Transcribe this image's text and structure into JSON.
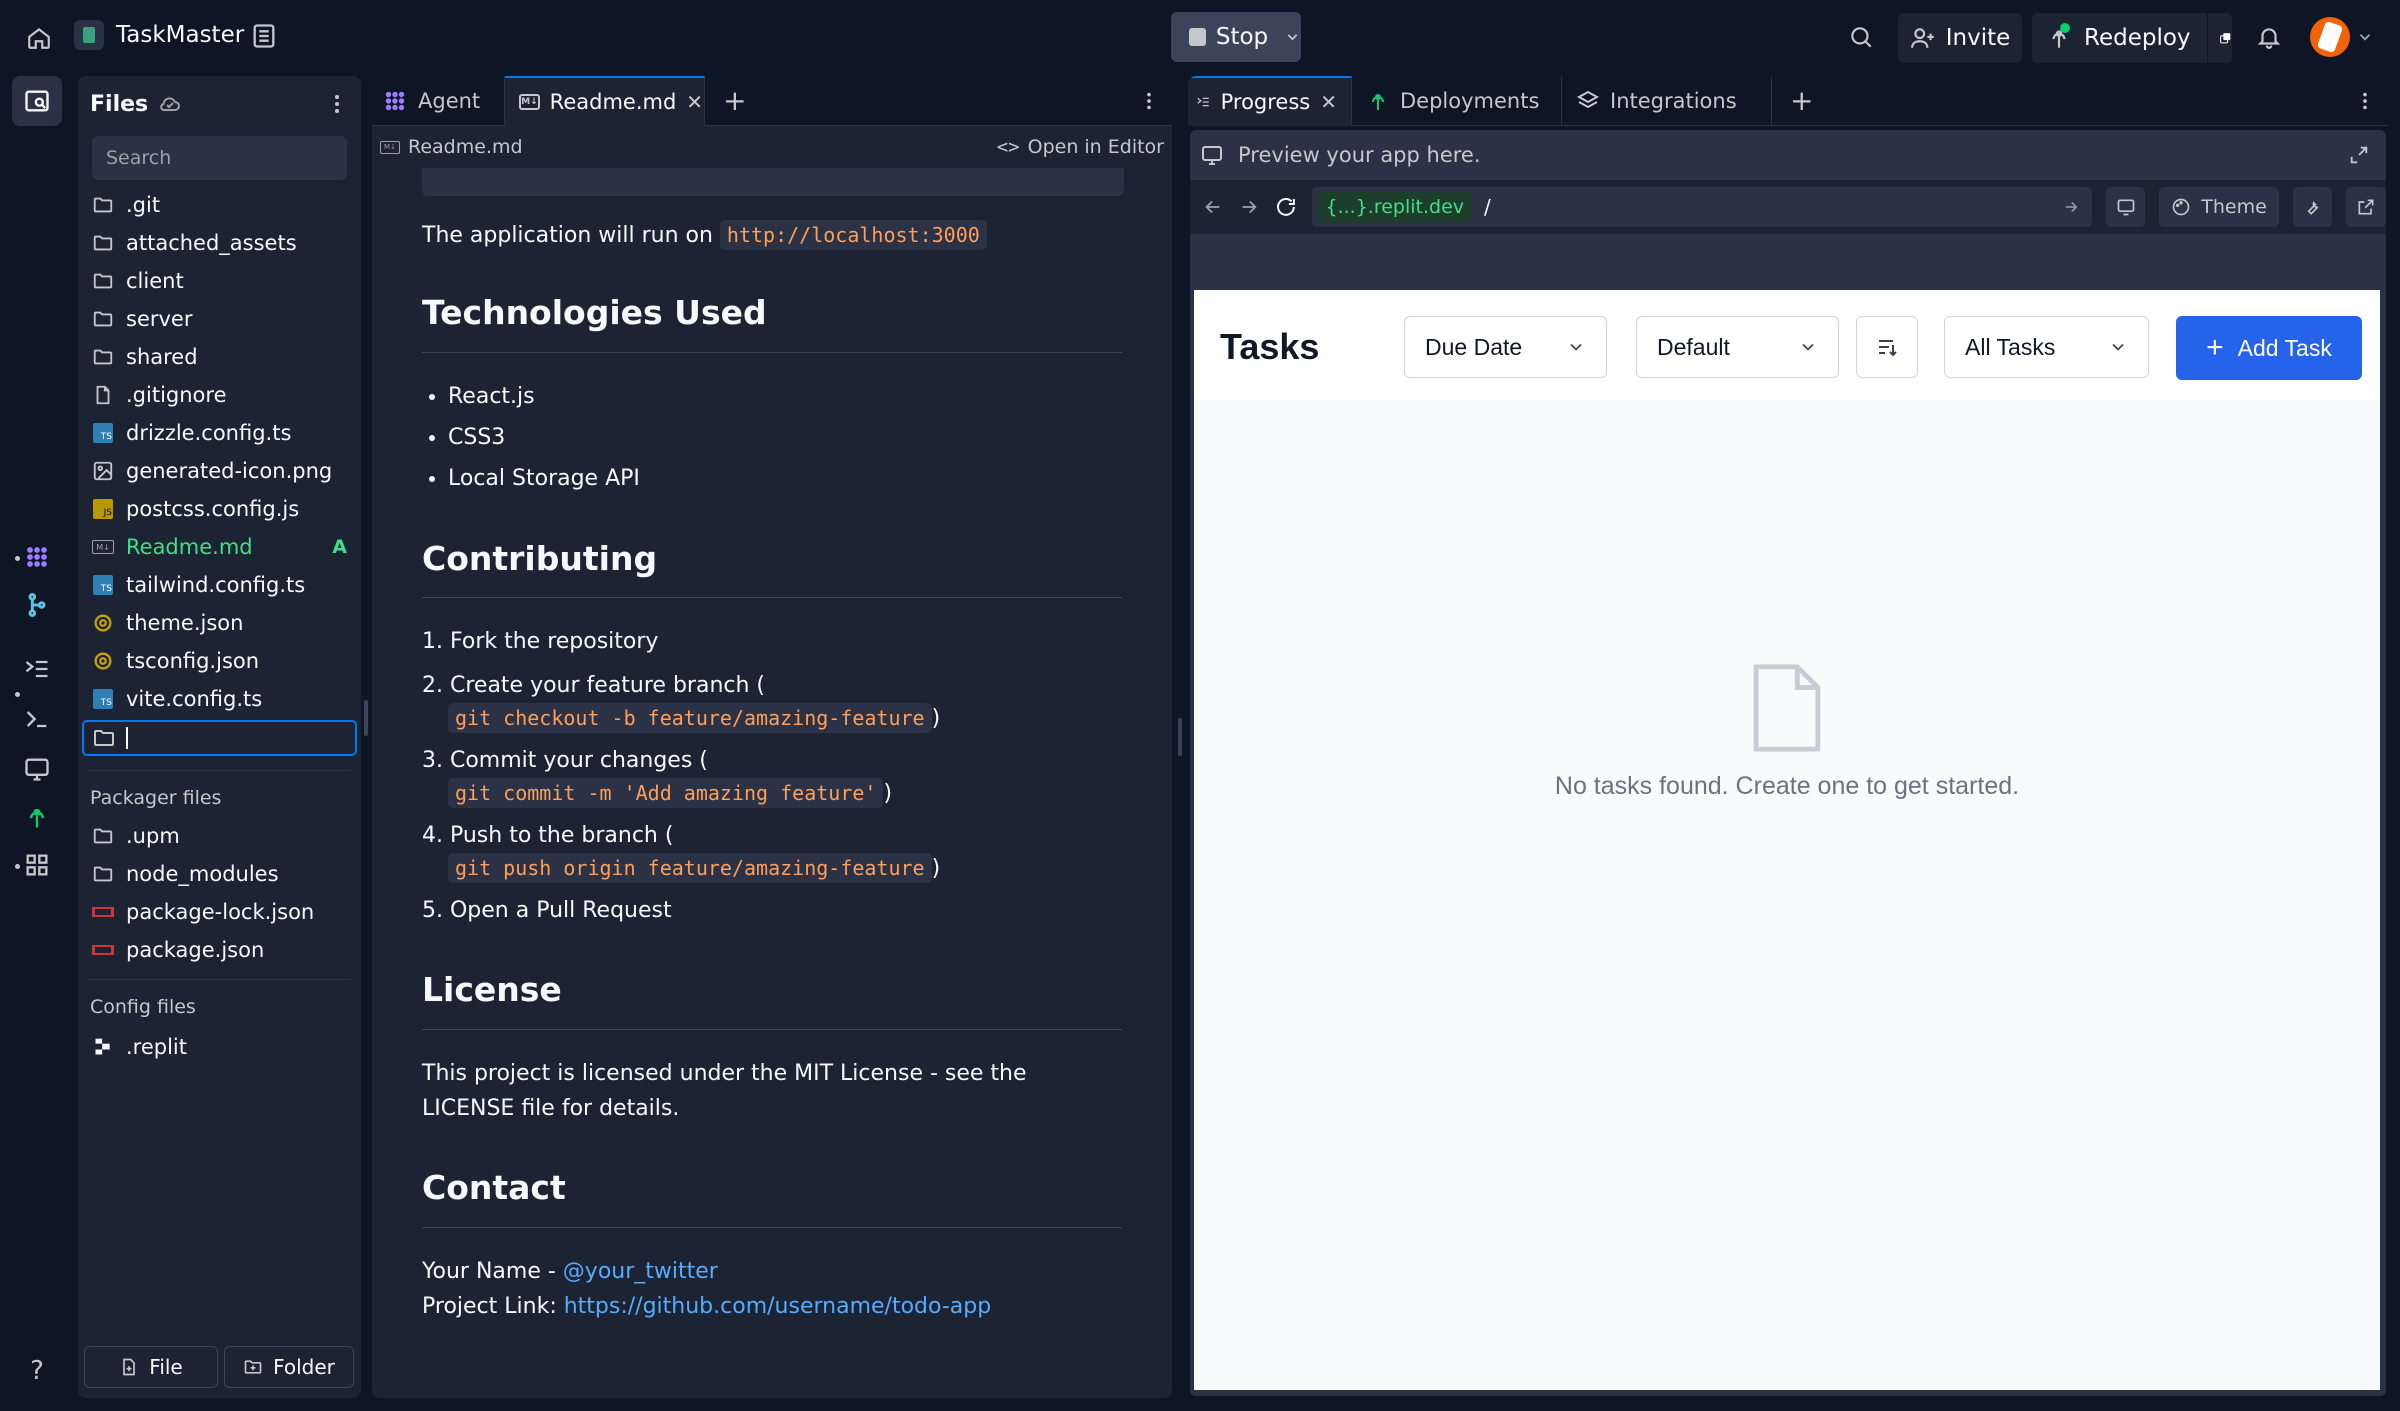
{
  "app": {
    "name": "TaskMaster"
  },
  "top": {
    "stop_label": "Stop",
    "invite_label": "Invite",
    "redeploy_label": "Redeploy"
  },
  "files": {
    "title": "Files",
    "search_placeholder": "Search",
    "items": [
      {
        "name": ".git",
        "icon": "folder-icon"
      },
      {
        "name": "attached_assets",
        "icon": "folder-icon"
      },
      {
        "name": "client",
        "icon": "folder-icon"
      },
      {
        "name": "server",
        "icon": "folder-icon"
      },
      {
        "name": "shared",
        "icon": "folder-icon"
      },
      {
        "name": ".gitignore",
        "icon": "file-icon"
      },
      {
        "name": "drizzle.config.ts",
        "icon": "typescript-icon"
      },
      {
        "name": "generated-icon.png",
        "icon": "image-icon"
      },
      {
        "name": "postcss.config.js",
        "icon": "javascript-icon"
      },
      {
        "name": "Readme.md",
        "icon": "markdown-icon",
        "badge": "A"
      },
      {
        "name": "tailwind.config.ts",
        "icon": "typescript-icon"
      },
      {
        "name": "theme.json",
        "icon": "json-icon"
      },
      {
        "name": "tsconfig.json",
        "icon": "json-icon"
      },
      {
        "name": "vite.config.ts",
        "icon": "typescript-icon"
      }
    ],
    "new_folder_value": "",
    "packager_title": "Packager files",
    "packager_items": [
      {
        "name": ".upm",
        "icon": "folder-icon"
      },
      {
        "name": "node_modules",
        "icon": "folder-icon"
      },
      {
        "name": "package-lock.json",
        "icon": "npm-icon"
      },
      {
        "name": "package.json",
        "icon": "npm-icon"
      }
    ],
    "config_title": "Config files",
    "config_items": [
      {
        "name": ".replit",
        "icon": "replit-icon"
      }
    ],
    "new_file_label": "File",
    "new_folder_label": "Folder"
  },
  "editor": {
    "tabs": [
      {
        "label": "Agent"
      },
      {
        "label": "Readme.md"
      }
    ],
    "breadcrumb": "Readme.md",
    "open_in_editor": "Open in Editor",
    "run_text": "The application will run on",
    "run_url": "http://localhost:3000",
    "tech_heading": "Technologies Used",
    "tech_items": [
      "React.js",
      "CSS3",
      "Local Storage API"
    ],
    "contrib_heading": "Contributing",
    "steps": [
      {
        "text": "1. Fork the repository"
      },
      {
        "text": "2. Create your feature branch (",
        "code": "git checkout -b feature/amazing-feature"
      },
      {
        "text": "3. Commit your changes (",
        "code": "git commit -m 'Add amazing feature'"
      },
      {
        "text": "4. Push to the branch (",
        "code": "git push origin feature/amazing-feature"
      },
      {
        "text": "5. Open a Pull Request"
      }
    ],
    "close_paren": ")",
    "license_heading": "License",
    "license_text": "This project is licensed under the MIT License - see the LICENSE file for details.",
    "contact_heading": "Contact",
    "contact_name": "Your Name - ",
    "contact_twitter": "@your_twitter",
    "contact_project": "Project Link: ",
    "contact_link": "https://github.com/username/todo-app"
  },
  "right": {
    "tabs": [
      {
        "label": "Progress"
      },
      {
        "label": "Deployments"
      },
      {
        "label": "Integrations"
      }
    ],
    "preview_text": "Preview your app here.",
    "url_host": "{...}.replit.dev",
    "url_path": "/",
    "theme_label": "Theme"
  },
  "app_preview": {
    "title": "Tasks",
    "sort_value": "Due Date",
    "order_value": "Default",
    "filter_value": "All Tasks",
    "add_label": "Add Task",
    "empty_text": "No tasks found. Create one to get started."
  }
}
